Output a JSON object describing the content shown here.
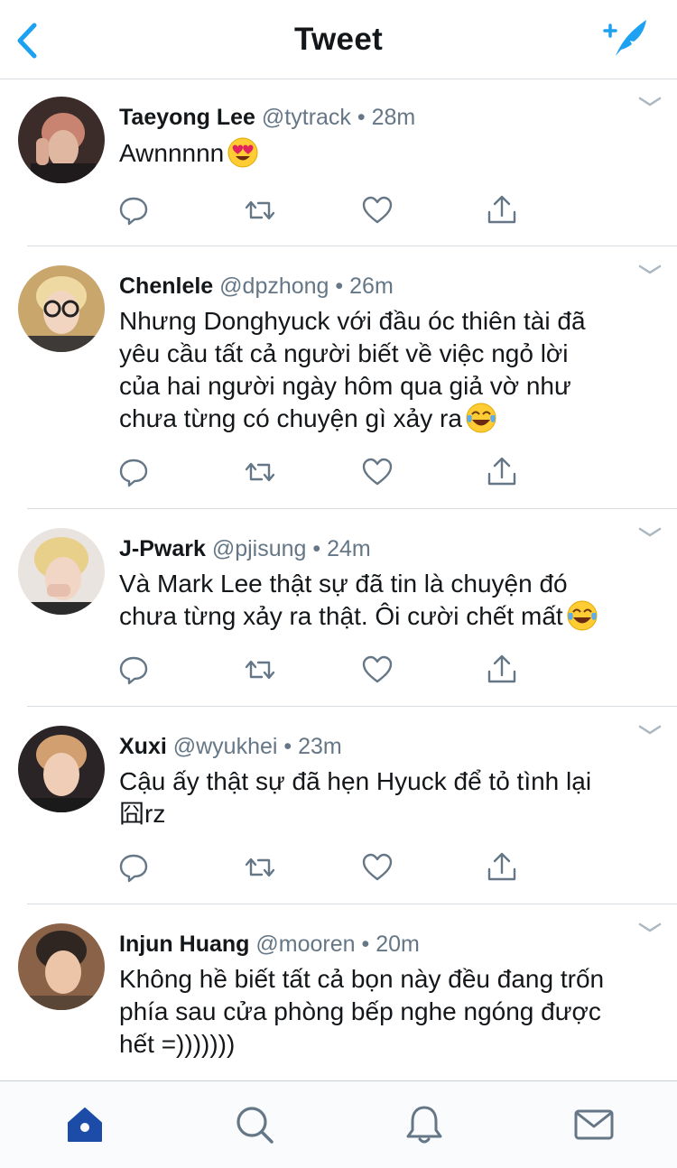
{
  "header": {
    "title": "Tweet",
    "back_icon": "chevron-left-icon",
    "compose_icon": "compose-feather-icon"
  },
  "colors": {
    "accent": "#1da1f2",
    "tab_active": "#1c4ba8",
    "text_primary": "#14171a",
    "text_secondary": "#657786",
    "divider": "#d8dde1"
  },
  "tweets": [
    {
      "name": "Taeyong Lee",
      "handle": "@tytrack",
      "dot": "•",
      "time": "28m",
      "lines": [
        "Awnnnnn"
      ],
      "emoji": "heart-eyes-emoji"
    },
    {
      "name": "Chenlele",
      "handle": "@dpzhong",
      "dot": "•",
      "time": "26m",
      "lines": [
        "Nhưng Donghyuck với đầu óc thiên tài đã",
        "yêu cầu tất cả người biết về việc ngỏ lời",
        "của hai người ngày hôm qua giả vờ như",
        "chưa từng có chuyện gì xảy ra"
      ],
      "emoji": "tears-of-joy-emoji"
    },
    {
      "name": "J-Pwark",
      "handle": "@pjisung",
      "dot": "•",
      "time": "24m",
      "lines": [
        "Và Mark Lee thật sự đã tin là chuyện đó",
        "chưa từng xảy ra thật. Ôi cười chết mất"
      ],
      "emoji": "tears-of-joy-emoji"
    },
    {
      "name": "Xuxi",
      "handle": "@wyukhei",
      "dot": "•",
      "time": "23m",
      "lines": [
        "Cậu ấy thật sự đã hẹn Hyuck để tỏ tình lại",
        "囧rz"
      ],
      "emoji": ""
    },
    {
      "name": "Injun Huang",
      "handle": "@mooren",
      "dot": "•",
      "time": "20m",
      "lines": [
        "Không hề biết tất cả bọn này đều đang trốn",
        "phía sau cửa phòng bếp nghe ngóng được",
        "hết =)))))))"
      ],
      "emoji": ""
    }
  ],
  "action_icons": [
    "reply-icon",
    "retweet-icon",
    "like-icon",
    "share-icon"
  ],
  "tabs": [
    "home-icon",
    "search-icon",
    "notifications-icon",
    "messages-icon"
  ]
}
